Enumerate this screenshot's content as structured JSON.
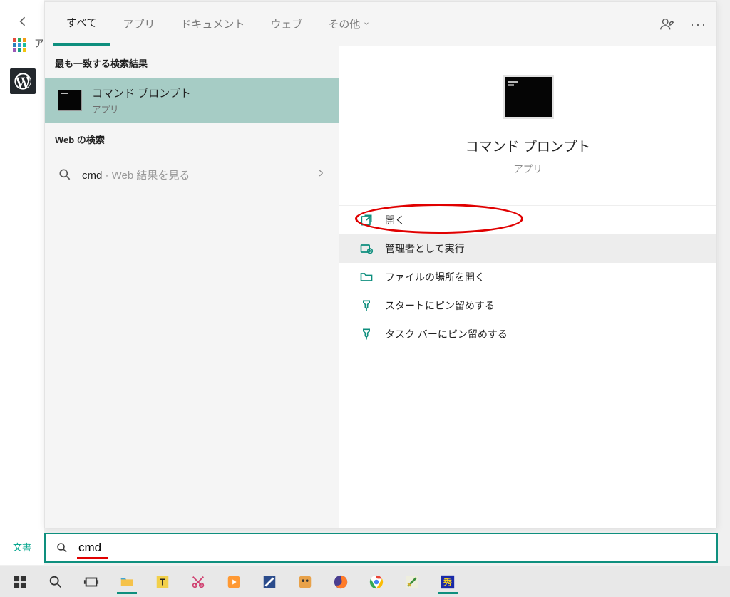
{
  "left": {
    "partial_label": "ア"
  },
  "tabs": {
    "all": "すべて",
    "apps": "アプリ",
    "docs": "ドキュメント",
    "web": "ウェブ",
    "more": "その他"
  },
  "sections": {
    "best_match": "最も一致する検索結果",
    "web_search": "Web の検索"
  },
  "best_match": {
    "title": "コマンド プロンプト",
    "subtitle": "アプリ"
  },
  "web_result": {
    "query": "cmd",
    "hint": " - Web 結果を見る"
  },
  "preview": {
    "title": "コマンド プロンプト",
    "subtitle": "アプリ"
  },
  "actions": {
    "open": "開く",
    "run_admin": "管理者として実行",
    "open_location": "ファイルの場所を開く",
    "pin_start": "スタートにピン留めする",
    "pin_taskbar": "タスク バーにピン留めする"
  },
  "docs_label": "文書",
  "search": {
    "value": "cmd"
  }
}
